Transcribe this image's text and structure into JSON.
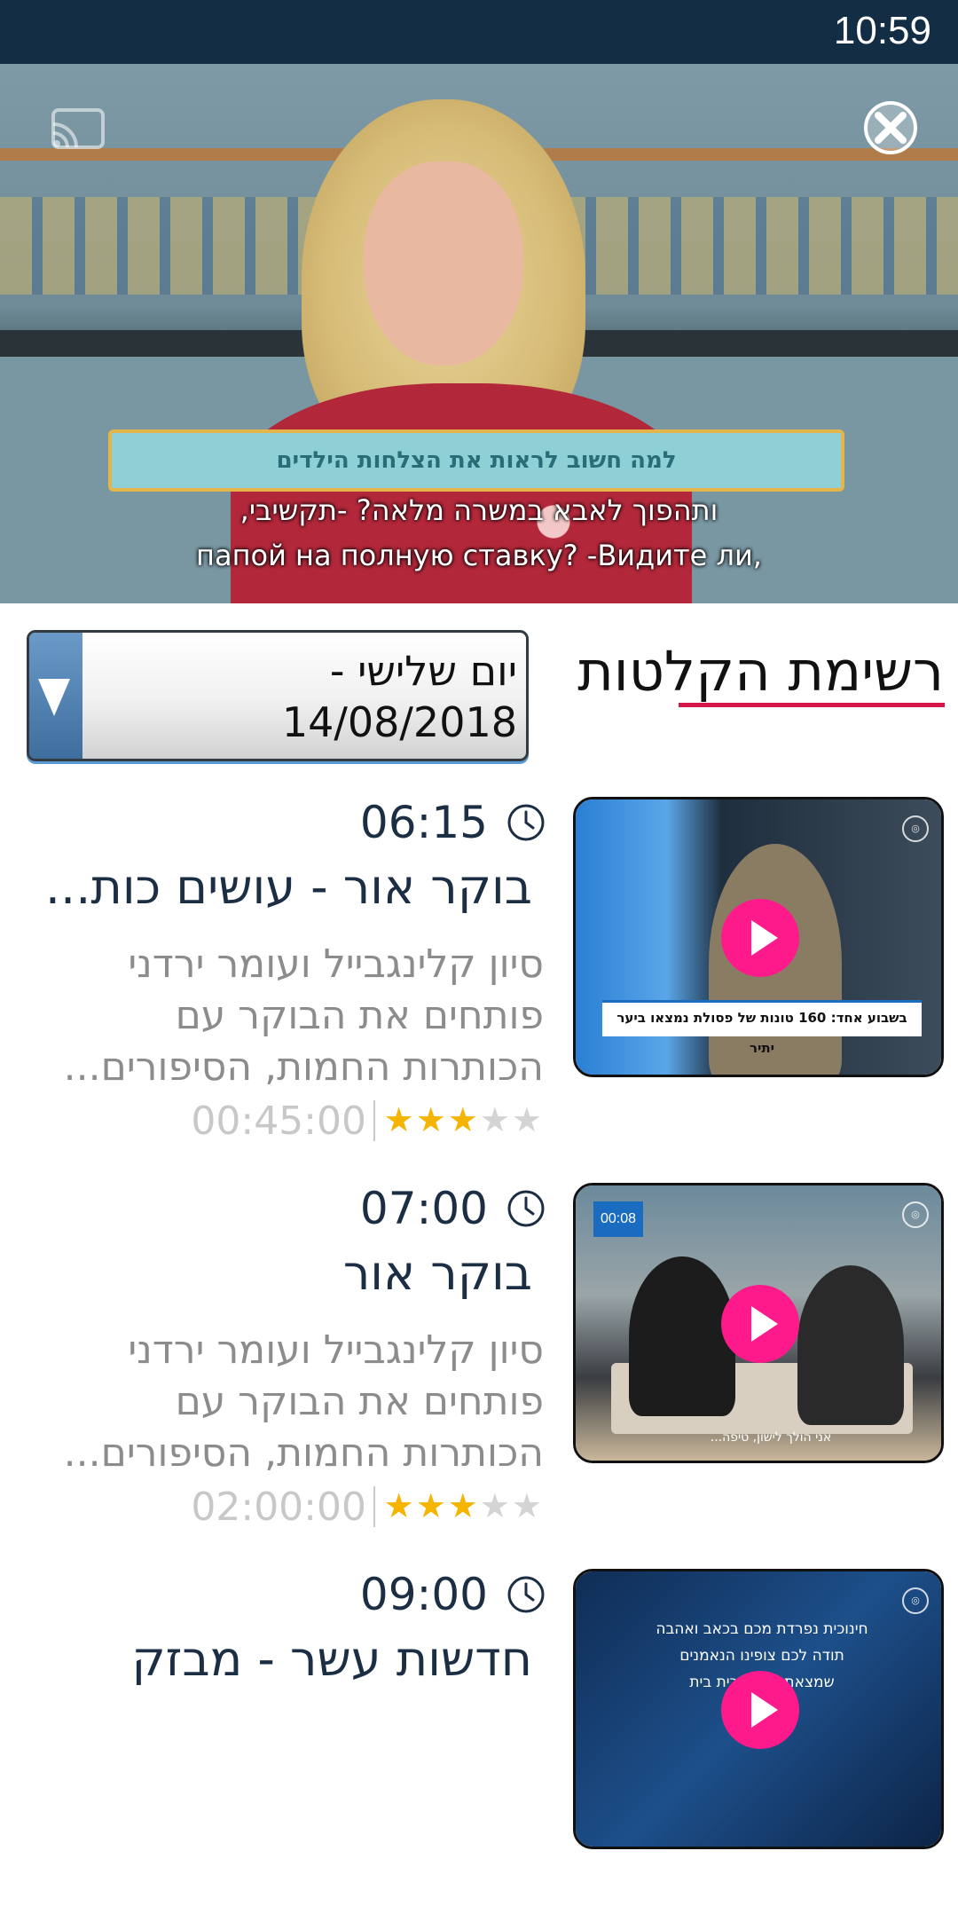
{
  "status_bar": {
    "time": "10:59"
  },
  "video": {
    "topic_bar": "למה חשוב לראות את הצלחות הילדים",
    "subtitle_line1": "ותהפוך לאבא במשרה מלאה? -תקשיבי,",
    "subtitle_line2": "папой на полную ставку? -Видите ли,"
  },
  "schedule": {
    "title": "רשימת הקלטות",
    "date_select": {
      "line1": "יום שלישי -",
      "line2": "14/08/2018"
    }
  },
  "episodes": [
    {
      "time": "06:15",
      "title": "בוקר אור - עושים כות...",
      "description_lines": [
        "סיון קלינגבייל ועומר ירדני",
        "פותחים את הבוקר עם",
        "הכותרות החמות, הסיפורים..."
      ],
      "duration": "00:45:00",
      "rating": 3,
      "rating_max": 5,
      "thumb_banner": "בשבוע אחד: 160 טונות של פסולת נמצאו ביער יתיר"
    },
    {
      "time": "07:00",
      "title": "בוקר אור",
      "description_lines": [
        "סיון קלינגבייל ועומר ירדני",
        "פותחים את הבוקר עם",
        "הכותרות החמות, הסיפורים..."
      ],
      "duration": "02:00:00",
      "rating": 3,
      "rating_max": 5,
      "thumb_badge": "00:08",
      "thumb_caption": "אני הולך לישון, טיפה..."
    },
    {
      "time": "09:00",
      "title": "חדשות עשר - מבזק",
      "thumb_text_lines": [
        "חינוכית נפרדת מכם בכאב ואהבה",
        "תודה לכם צופינו הנאמנים",
        "שמצאתם בחינוכית בית"
      ]
    }
  ],
  "colors": {
    "status_bar": "#122d44",
    "accent_underline": "#d4164b",
    "play_button": "#ff1a8c",
    "star_on": "#f5b400",
    "star_off": "#d4d4d4"
  },
  "icons": [
    "cast-icon",
    "close-icon",
    "clock-icon",
    "play-icon",
    "chevron-down-icon",
    "star-icon"
  ]
}
